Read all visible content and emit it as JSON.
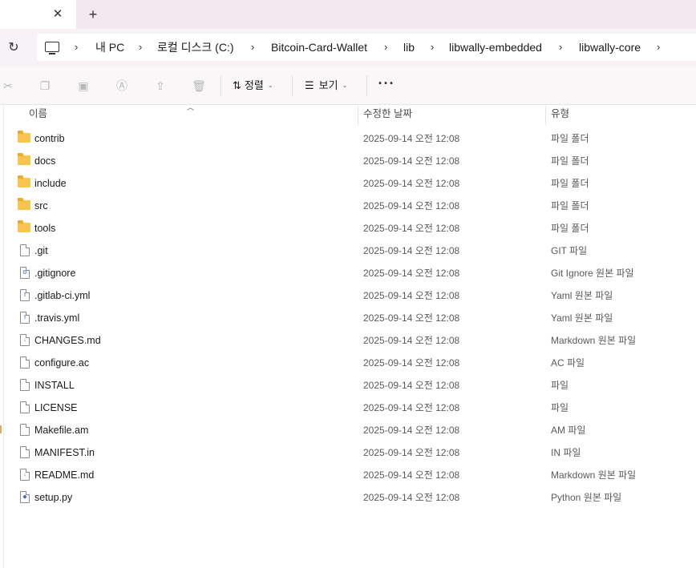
{
  "tabs": {
    "close_label": "✕",
    "new_tab_label": "+"
  },
  "address_bar": {
    "crumbs": [
      "내 PC",
      "로컬 디스크 (C:)",
      "Bitcoin-Card-Wallet",
      "lib",
      "libwally-embedded",
      "libwally-core"
    ],
    "separator": "›"
  },
  "command_bar": {
    "sort_label": "정렬",
    "view_label": "보기",
    "more_label": "···"
  },
  "columns": {
    "name": "이름",
    "date": "수정한 날짜",
    "type": "유형"
  },
  "files": [
    {
      "name": "contrib",
      "date": "2025-09-14 오전 12:08",
      "type": "파일 폴더",
      "icon": "folder-icon"
    },
    {
      "name": "docs",
      "date": "2025-09-14 오전 12:08",
      "type": "파일 폴더",
      "icon": "folder-icon"
    },
    {
      "name": "include",
      "date": "2025-09-14 오전 12:08",
      "type": "파일 폴더",
      "icon": "folder-icon"
    },
    {
      "name": "src",
      "date": "2025-09-14 오전 12:08",
      "type": "파일 폴더",
      "icon": "folder-icon"
    },
    {
      "name": "tools",
      "date": "2025-09-14 오전 12:08",
      "type": "파일 폴더",
      "icon": "folder-icon"
    },
    {
      "name": ".git",
      "date": "2025-09-14 오전 12:08",
      "type": "GIT 파일",
      "icon": "file-icon"
    },
    {
      "name": ".gitignore",
      "date": "2025-09-14 오전 12:08",
      "type": "Git Ignore 원본 파일",
      "icon": "gear-file-icon"
    },
    {
      "name": ".gitlab-ci.yml",
      "date": "2025-09-14 오전 12:08",
      "type": "Yaml 원본 파일",
      "icon": "code-file-icon"
    },
    {
      "name": ".travis.yml",
      "date": "2025-09-14 오전 12:08",
      "type": "Yaml 원본 파일",
      "icon": "code-file-icon"
    },
    {
      "name": "CHANGES.md",
      "date": "2025-09-14 오전 12:08",
      "type": "Markdown 원본 파일",
      "icon": "markdown-file-icon"
    },
    {
      "name": "configure.ac",
      "date": "2025-09-14 오전 12:08",
      "type": "AC 파일",
      "icon": "file-icon"
    },
    {
      "name": "INSTALL",
      "date": "2025-09-14 오전 12:08",
      "type": "파일",
      "icon": "file-icon"
    },
    {
      "name": "LICENSE",
      "date": "2025-09-14 오전 12:08",
      "type": "파일",
      "icon": "file-icon"
    },
    {
      "name": "Makefile.am",
      "date": "2025-09-14 오전 12:08",
      "type": "AM 파일",
      "icon": "file-icon"
    },
    {
      "name": "MANIFEST.in",
      "date": "2025-09-14 오전 12:08",
      "type": "IN 파일",
      "icon": "file-icon"
    },
    {
      "name": "README.md",
      "date": "2025-09-14 오전 12:08",
      "type": "Markdown 원본 파일",
      "icon": "markdown-file-icon"
    },
    {
      "name": "setup.py",
      "date": "2025-09-14 오전 12:08",
      "type": "Python 원본 파일",
      "icon": "python-file-icon"
    }
  ],
  "colors": {
    "tab_strip": "#f3e8ef",
    "folder": "#f8c44f",
    "accent": "#4a6fa5"
  }
}
